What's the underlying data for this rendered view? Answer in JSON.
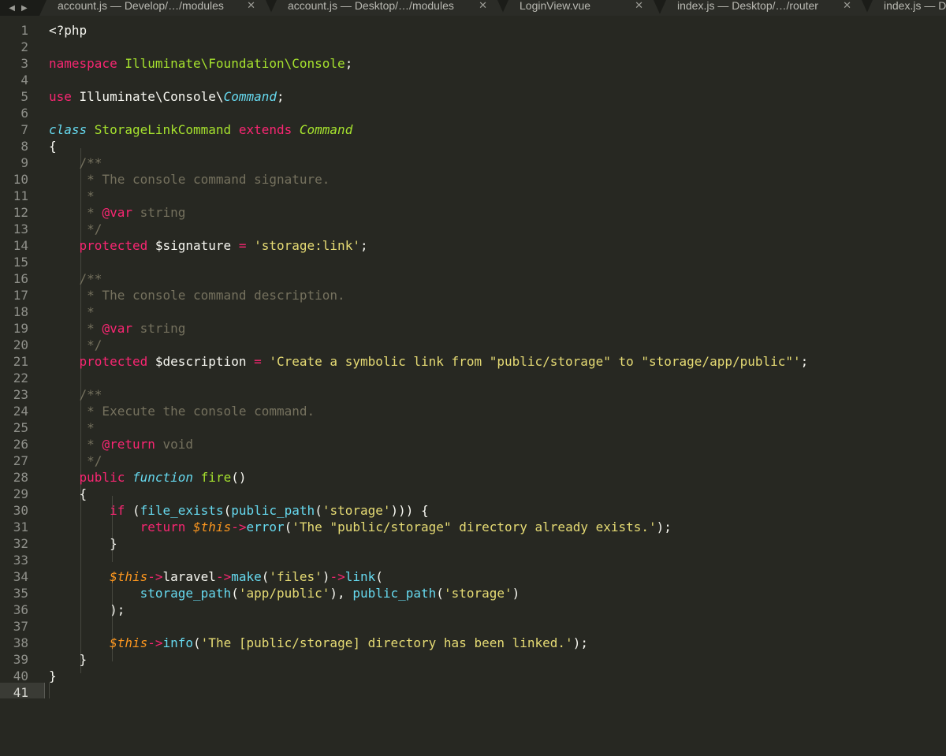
{
  "tabs": [
    {
      "label": "account.js — Develop/…/modules",
      "close": "✕"
    },
    {
      "label": "account.js — Desktop/…/modules",
      "close": "✕"
    },
    {
      "label": "LoginView.vue",
      "close": "✕"
    },
    {
      "label": "index.js — Desktop/…/router",
      "close": "✕"
    },
    {
      "label": "index.js — Desk",
      "close": "✕"
    }
  ],
  "nav": {
    "back": "◀",
    "forward": "▶"
  },
  "editor": {
    "language": "PHP",
    "theme": "Monokai",
    "colors": {
      "background": "#272822",
      "keyword": "#f92672",
      "class_name": "#a6e22e",
      "string": "#e6db74",
      "comment": "#75715e",
      "support": "#66d9ef",
      "variable": "#fd971f"
    },
    "active_line": 41,
    "lines": [
      {
        "n": "1",
        "tokens": [
          [
            "p",
            "<?php"
          ]
        ]
      },
      {
        "n": "2",
        "tokens": []
      },
      {
        "n": "3",
        "tokens": [
          [
            "k",
            "namespace "
          ],
          [
            "t",
            "Illuminate\\Foundation\\Console"
          ],
          [
            "p",
            ";"
          ]
        ]
      },
      {
        "n": "4",
        "tokens": []
      },
      {
        "n": "5",
        "tokens": [
          [
            "k",
            "use "
          ],
          [
            "p",
            "Illuminate\\Console\\"
          ],
          [
            "bi",
            "Command"
          ],
          [
            "p",
            ";"
          ]
        ]
      },
      {
        "n": "6",
        "tokens": []
      },
      {
        "n": "7",
        "tokens": [
          [
            "bi",
            "class "
          ],
          [
            "t",
            "StorageLinkCommand "
          ],
          [
            "k",
            "extends "
          ],
          [
            "ti",
            "Command"
          ]
        ]
      },
      {
        "n": "8",
        "tokens": [
          [
            "p",
            "{"
          ]
        ]
      },
      {
        "n": "9",
        "tokens": [
          [
            "c",
            "    /**"
          ]
        ]
      },
      {
        "n": "10",
        "tokens": [
          [
            "c",
            "     * The console command signature."
          ]
        ]
      },
      {
        "n": "11",
        "tokens": [
          [
            "c",
            "     *"
          ]
        ]
      },
      {
        "n": "12",
        "tokens": [
          [
            "c",
            "     * "
          ],
          [
            "k",
            "@var"
          ],
          [
            "c",
            " string"
          ]
        ]
      },
      {
        "n": "13",
        "tokens": [
          [
            "c",
            "     */"
          ]
        ]
      },
      {
        "n": "14",
        "tokens": [
          [
            "p",
            "    "
          ],
          [
            "k",
            "protected "
          ],
          [
            "p",
            "$signature "
          ],
          [
            "k",
            "= "
          ],
          [
            "s",
            "'storage:link'"
          ],
          [
            "p",
            ";"
          ]
        ]
      },
      {
        "n": "15",
        "tokens": []
      },
      {
        "n": "16",
        "tokens": [
          [
            "c",
            "    /**"
          ]
        ]
      },
      {
        "n": "17",
        "tokens": [
          [
            "c",
            "     * The console command description."
          ]
        ]
      },
      {
        "n": "18",
        "tokens": [
          [
            "c",
            "     *"
          ]
        ]
      },
      {
        "n": "19",
        "tokens": [
          [
            "c",
            "     * "
          ],
          [
            "k",
            "@var"
          ],
          [
            "c",
            " string"
          ]
        ]
      },
      {
        "n": "20",
        "tokens": [
          [
            "c",
            "     */"
          ]
        ]
      },
      {
        "n": "21",
        "tokens": [
          [
            "p",
            "    "
          ],
          [
            "k",
            "protected "
          ],
          [
            "p",
            "$description "
          ],
          [
            "k",
            "= "
          ],
          [
            "s",
            "'Create a symbolic link from \"public/storage\" to \"storage/app/public\"'"
          ],
          [
            "p",
            ";"
          ]
        ]
      },
      {
        "n": "22",
        "tokens": []
      },
      {
        "n": "23",
        "tokens": [
          [
            "c",
            "    /**"
          ]
        ]
      },
      {
        "n": "24",
        "tokens": [
          [
            "c",
            "     * Execute the console command."
          ]
        ]
      },
      {
        "n": "25",
        "tokens": [
          [
            "c",
            "     *"
          ]
        ]
      },
      {
        "n": "26",
        "tokens": [
          [
            "c",
            "     * "
          ],
          [
            "k",
            "@return"
          ],
          [
            "c",
            " void"
          ]
        ]
      },
      {
        "n": "27",
        "tokens": [
          [
            "c",
            "     */"
          ]
        ]
      },
      {
        "n": "28",
        "tokens": [
          [
            "p",
            "    "
          ],
          [
            "k",
            "public "
          ],
          [
            "bi",
            "function "
          ],
          [
            "t",
            "fire"
          ],
          [
            "p",
            "()"
          ]
        ]
      },
      {
        "n": "29",
        "tokens": [
          [
            "p",
            "    {"
          ]
        ]
      },
      {
        "n": "30",
        "tokens": [
          [
            "p",
            "        "
          ],
          [
            "k",
            "if "
          ],
          [
            "p",
            "("
          ],
          [
            "fn",
            "file_exists"
          ],
          [
            "p",
            "("
          ],
          [
            "fn",
            "public_path"
          ],
          [
            "p",
            "("
          ],
          [
            "s",
            "'storage'"
          ],
          [
            "p",
            "))) {"
          ]
        ]
      },
      {
        "n": "31",
        "tokens": [
          [
            "p",
            "            "
          ],
          [
            "k",
            "return "
          ],
          [
            "var",
            "$this"
          ],
          [
            "k",
            "->"
          ],
          [
            "fn",
            "error"
          ],
          [
            "p",
            "("
          ],
          [
            "s",
            "'The \"public/storage\" directory already exists.'"
          ],
          [
            "p",
            ");"
          ]
        ]
      },
      {
        "n": "32",
        "tokens": [
          [
            "p",
            "        }"
          ]
        ]
      },
      {
        "n": "33",
        "tokens": []
      },
      {
        "n": "34",
        "tokens": [
          [
            "p",
            "        "
          ],
          [
            "var",
            "$this"
          ],
          [
            "k",
            "->"
          ],
          [
            "p",
            "laravel"
          ],
          [
            "k",
            "->"
          ],
          [
            "fn",
            "make"
          ],
          [
            "p",
            "("
          ],
          [
            "s",
            "'files'"
          ],
          [
            "p",
            ")"
          ],
          [
            "k",
            "->"
          ],
          [
            "fn",
            "link"
          ],
          [
            "p",
            "("
          ]
        ]
      },
      {
        "n": "35",
        "tokens": [
          [
            "p",
            "            "
          ],
          [
            "fn",
            "storage_path"
          ],
          [
            "p",
            "("
          ],
          [
            "s",
            "'app/public'"
          ],
          [
            "p",
            "), "
          ],
          [
            "fn",
            "public_path"
          ],
          [
            "p",
            "("
          ],
          [
            "s",
            "'storage'"
          ],
          [
            "p",
            ")"
          ]
        ]
      },
      {
        "n": "36",
        "tokens": [
          [
            "p",
            "        );"
          ]
        ]
      },
      {
        "n": "37",
        "tokens": []
      },
      {
        "n": "38",
        "tokens": [
          [
            "p",
            "        "
          ],
          [
            "var",
            "$this"
          ],
          [
            "k",
            "->"
          ],
          [
            "fn",
            "info"
          ],
          [
            "p",
            "("
          ],
          [
            "s",
            "'The [public/storage] directory has been linked.'"
          ],
          [
            "p",
            ");"
          ]
        ]
      },
      {
        "n": "39",
        "tokens": [
          [
            "p",
            "    }"
          ]
        ]
      },
      {
        "n": "40",
        "tokens": [
          [
            "p",
            "}"
          ]
        ]
      },
      {
        "n": "41",
        "tokens": []
      }
    ]
  }
}
